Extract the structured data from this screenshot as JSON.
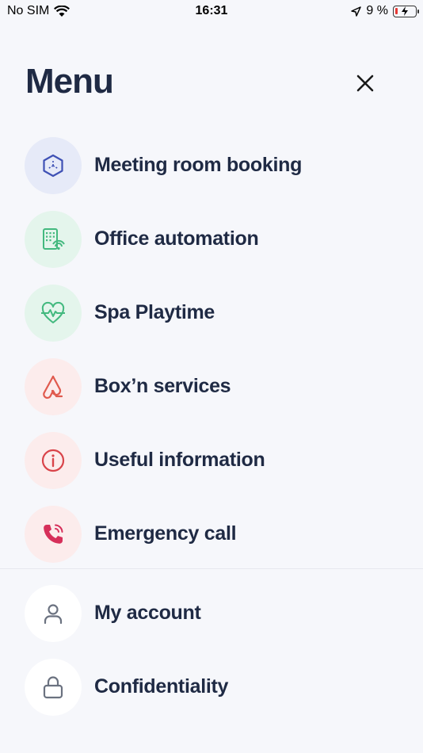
{
  "status_bar": {
    "carrier": "No SIM",
    "time": "16:31",
    "battery": "9 %"
  },
  "header": {
    "title": "Menu"
  },
  "menu_items": [
    {
      "label": "Meeting room booking",
      "icon": "cube-icon",
      "bg": "#e6eaf8",
      "color": "#3f51b5"
    },
    {
      "label": "Office automation",
      "icon": "building-wifi-icon",
      "bg": "#e4f5ec",
      "color": "#43b97f"
    },
    {
      "label": "Spa Playtime",
      "icon": "heartbeat-icon",
      "bg": "#e4f5ec",
      "color": "#43b97f"
    },
    {
      "label": "Box’n services",
      "icon": "bell-rope-icon",
      "bg": "#fcecec",
      "color": "#e05a4e"
    },
    {
      "label": "Useful information",
      "icon": "info-icon",
      "bg": "#fcecec",
      "color": "#d9444a"
    },
    {
      "label": "Emergency call",
      "icon": "phone-ringing-icon",
      "bg": "#fcecec",
      "color": "#d62f5a"
    }
  ],
  "account_items": [
    {
      "label": "My account",
      "icon": "user-icon",
      "bg": "#ffffff",
      "color": "#6b7280"
    },
    {
      "label": "Confidentiality",
      "icon": "lock-icon",
      "bg": "#ffffff",
      "color": "#6b7280"
    }
  ]
}
